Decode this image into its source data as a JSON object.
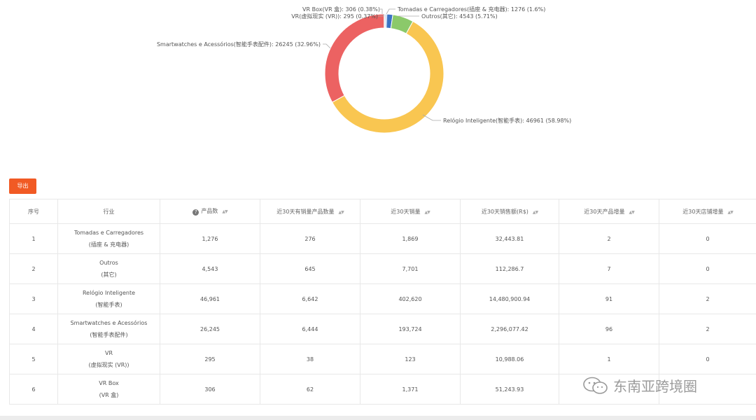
{
  "chart_data": {
    "type": "pie",
    "donut": true,
    "categories": [
      "VR Box(VR 盒)",
      "VR(虚拟现实 (VR))",
      "Tomadas e Carregadores(插座 & 充电器)",
      "Outros(其它)",
      "Relógio Inteligente(智能手表)",
      "Smartwatches e Acessórios(智能手表配件)"
    ],
    "values": [
      306,
      295,
      1276,
      4543,
      46961,
      26245
    ],
    "labels": [
      "VR Box(VR 盒): 306 (0.38%)",
      "VR(虚拟现实 (VR)): 295 (0.37%)",
      "Tomadas e Carregadores(插座 & 充电器): 1276 (1.6%)",
      "Outros(其它): 4543 (5.71%)",
      "Relógio Inteligente(智能手表): 46961 (58.98%)",
      "Smartwatches e Acessórios(智能手表配件): 26245 (32.96%)"
    ],
    "colors": [
      "#e0e0e0",
      "#8cb4e8",
      "#3b73c4",
      "#8bc96a",
      "#f9c651",
      "#ec6262"
    ]
  },
  "toolbar": {
    "export_label": "导出"
  },
  "table": {
    "headers": [
      "序号",
      "行业",
      "产品数",
      "近30天有销量产品数量",
      "近30天销量",
      "近30天销售额(R$)",
      "近30天产品增量",
      "近30天店铺增量"
    ],
    "sortable": [
      false,
      false,
      true,
      true,
      true,
      true,
      true,
      true
    ],
    "rows": [
      {
        "idx": "1",
        "name": "Tomadas e Carregadores",
        "cn": "(插座 & 充电器)",
        "products": "1,276",
        "sold_products": "276",
        "sales": "1,869",
        "revenue": "32,443.81",
        "product_inc": "2",
        "shop_inc": "0"
      },
      {
        "idx": "2",
        "name": "Outros",
        "cn": "(其它)",
        "products": "4,543",
        "sold_products": "645",
        "sales": "7,701",
        "revenue": "112,286.7",
        "product_inc": "7",
        "shop_inc": "0"
      },
      {
        "idx": "3",
        "name": "Relógio Inteligente",
        "cn": "(智能手表)",
        "products": "46,961",
        "sold_products": "6,642",
        "sales": "402,620",
        "revenue": "14,480,900.94",
        "product_inc": "91",
        "shop_inc": "2"
      },
      {
        "idx": "4",
        "name": "Smartwatches e Acessórios",
        "cn": "(智能手表配件)",
        "products": "26,245",
        "sold_products": "6,444",
        "sales": "193,724",
        "revenue": "2,296,077.42",
        "product_inc": "96",
        "shop_inc": "2"
      },
      {
        "idx": "5",
        "name": "VR",
        "cn": "(虚拟现实 (VR))",
        "products": "295",
        "sold_products": "38",
        "sales": "123",
        "revenue": "10,988.06",
        "product_inc": "1",
        "shop_inc": "0"
      },
      {
        "idx": "6",
        "name": "VR Box",
        "cn": "(VR 盒)",
        "products": "306",
        "sold_products": "62",
        "sales": "1,371",
        "revenue": "51,243.93",
        "product_inc": "",
        "shop_inc": ""
      }
    ]
  },
  "watermark": {
    "text": "东南亚跨境圈",
    "icon": "wechat-icon"
  }
}
